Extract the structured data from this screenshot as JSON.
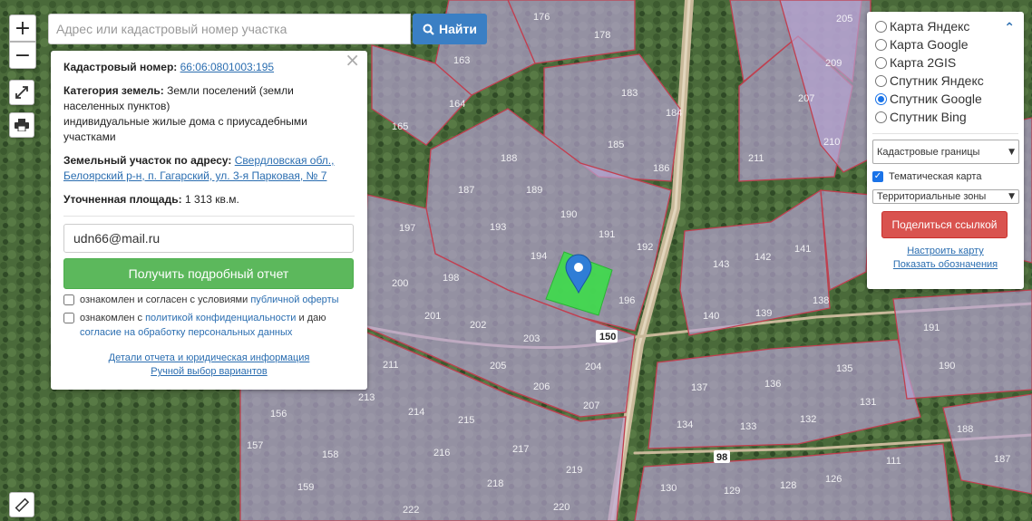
{
  "colors": {
    "accent": "#3a7fc4",
    "report_green": "#5cb85c",
    "share_red": "#d9534f",
    "parcel_fill": "#b8a3d4",
    "parcel_border": "#c04050",
    "selected_parcel": "#3ddc4a",
    "marker": "#2f7dd6"
  },
  "map_controls": {
    "zoom_in": "+",
    "zoom_out": "−",
    "fullscreen_icon": "fullscreen-icon",
    "print_icon": "printer-icon",
    "ruler_icon": "ruler-icon"
  },
  "search": {
    "placeholder": "Адрес или кадастровый номер участка",
    "value": "",
    "button_label": "Найти",
    "button_icon": "search-icon"
  },
  "info": {
    "cadastral_label": "Кадастровый номер:",
    "cadastral_number": "66:06:0801003:195",
    "category_label": "Категория земель:",
    "category_value": "Земли поселений (земли населенных пунктов)",
    "use_value": "индивидуальные жилые дома с приусадебными участками",
    "address_label": "Земельный участок по адресу:",
    "address_value": "Свердловская обл., Белоярский р-н, п. Гагарский, ул. 3-я Парковая, № 7",
    "area_label": "Уточненная площадь:",
    "area_value": "1 313 кв.м.",
    "email_value": "udn66@mail.ru",
    "report_button": "Получить подробный отчет",
    "agree1_text": "ознакомлен и согласен с условиями",
    "agree1_link": "публичной оферты",
    "agree2_text": "ознакомлен с",
    "agree2_link": "политикой конфиденциальности",
    "agree2_text2": "и даю",
    "agree2_link2": "согласие на обработку персональных данных",
    "footer_link1": "Детали отчета и юридическая информация",
    "footer_link2": "Ручной выбор вариантов",
    "close": "×"
  },
  "layers": {
    "options": [
      {
        "label": "Карта Яндекс",
        "checked": false
      },
      {
        "label": "Карта Google",
        "checked": false
      },
      {
        "label": "Карта 2GIS",
        "checked": false
      },
      {
        "label": "Спутник Яндекс",
        "checked": false
      },
      {
        "label": "Спутник Google",
        "checked": true
      },
      {
        "label": "Спутник Bing",
        "checked": false
      }
    ],
    "boundaries_select": "Кадастровые границы",
    "thematic_label": "Тематическая карта",
    "thematic_checked": true,
    "zones_select": "Территориальные зоны",
    "share_button": "Поделиться ссылкой",
    "configure_link": "Настроить карту",
    "legend_link": "Показать обозначения"
  },
  "parcel_labels": [
    "176",
    "178",
    "163",
    "164",
    "165",
    "183",
    "184",
    "185",
    "186",
    "188",
    "187",
    "189",
    "190",
    "191",
    "192",
    "193",
    "194",
    "196",
    "197",
    "198",
    "200",
    "201",
    "202",
    "203",
    "204",
    "205",
    "206",
    "207",
    "211",
    "213",
    "214",
    "215",
    "216",
    "217",
    "218",
    "219",
    "220",
    "222",
    "156",
    "157",
    "158",
    "159",
    "205",
    "207",
    "209",
    "210",
    "211",
    "143",
    "142",
    "141",
    "140",
    "139",
    "138",
    "137",
    "136",
    "135",
    "134",
    "133",
    "132",
    "131",
    "130",
    "129",
    "128",
    "126",
    "111",
    "191",
    "190",
    "188",
    "187",
    "186",
    "150",
    "98"
  ]
}
